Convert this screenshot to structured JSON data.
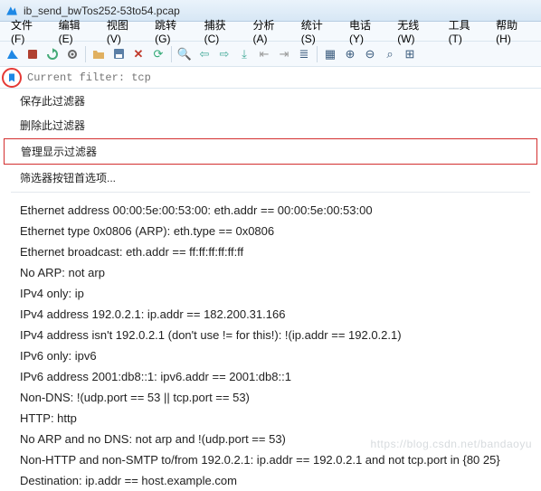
{
  "window": {
    "title": "ib_send_bwTos252-53to54.pcap"
  },
  "menu": {
    "file": "文件(F)",
    "edit": "编辑(E)",
    "view": "视图(V)",
    "go": "跳转(G)",
    "capture": "捕获(C)",
    "analyze": "分析(A)",
    "stats": "统计(S)",
    "tele": "电话(Y)",
    "wireless": "无线(W)",
    "tools": "工具(T)",
    "help": "帮助(H)"
  },
  "filter": {
    "placeholder": "Current filter: tcp"
  },
  "dropdown": {
    "save": "保存此过滤器",
    "delete": "删除此过滤器",
    "manage": "管理显示过滤器",
    "prefs": "筛选器按钮首选项..."
  },
  "examples": [
    "Ethernet address 00:00:5e:00:53:00: eth.addr == 00:00:5e:00:53:00",
    "Ethernet type 0x0806 (ARP): eth.type == 0x0806",
    "Ethernet broadcast: eth.addr == ff:ff:ff:ff:ff:ff",
    "No ARP: not arp",
    "IPv4 only: ip",
    "IPv4 address 192.0.2.1: ip.addr == 182.200.31.166",
    "IPv4 address isn't 192.0.2.1 (don't use != for this!): !(ip.addr == 192.0.2.1)",
    "IPv6 only: ipv6",
    "IPv6 address 2001:db8::1: ipv6.addr == 2001:db8::1",
    "Non-DNS: !(udp.port == 53 || tcp.port == 53)",
    "HTTP: http",
    "No ARP and no DNS: not arp and !(udp.port == 53)",
    "Non-HTTP and non-SMTP to/from 192.0.2.1: ip.addr == 192.0.2.1 and not tcp.port in {80 25}",
    "Destination: ip.addr == host.example.com"
  ],
  "watermark": "https://blog.csdn.net/bandaoyu"
}
